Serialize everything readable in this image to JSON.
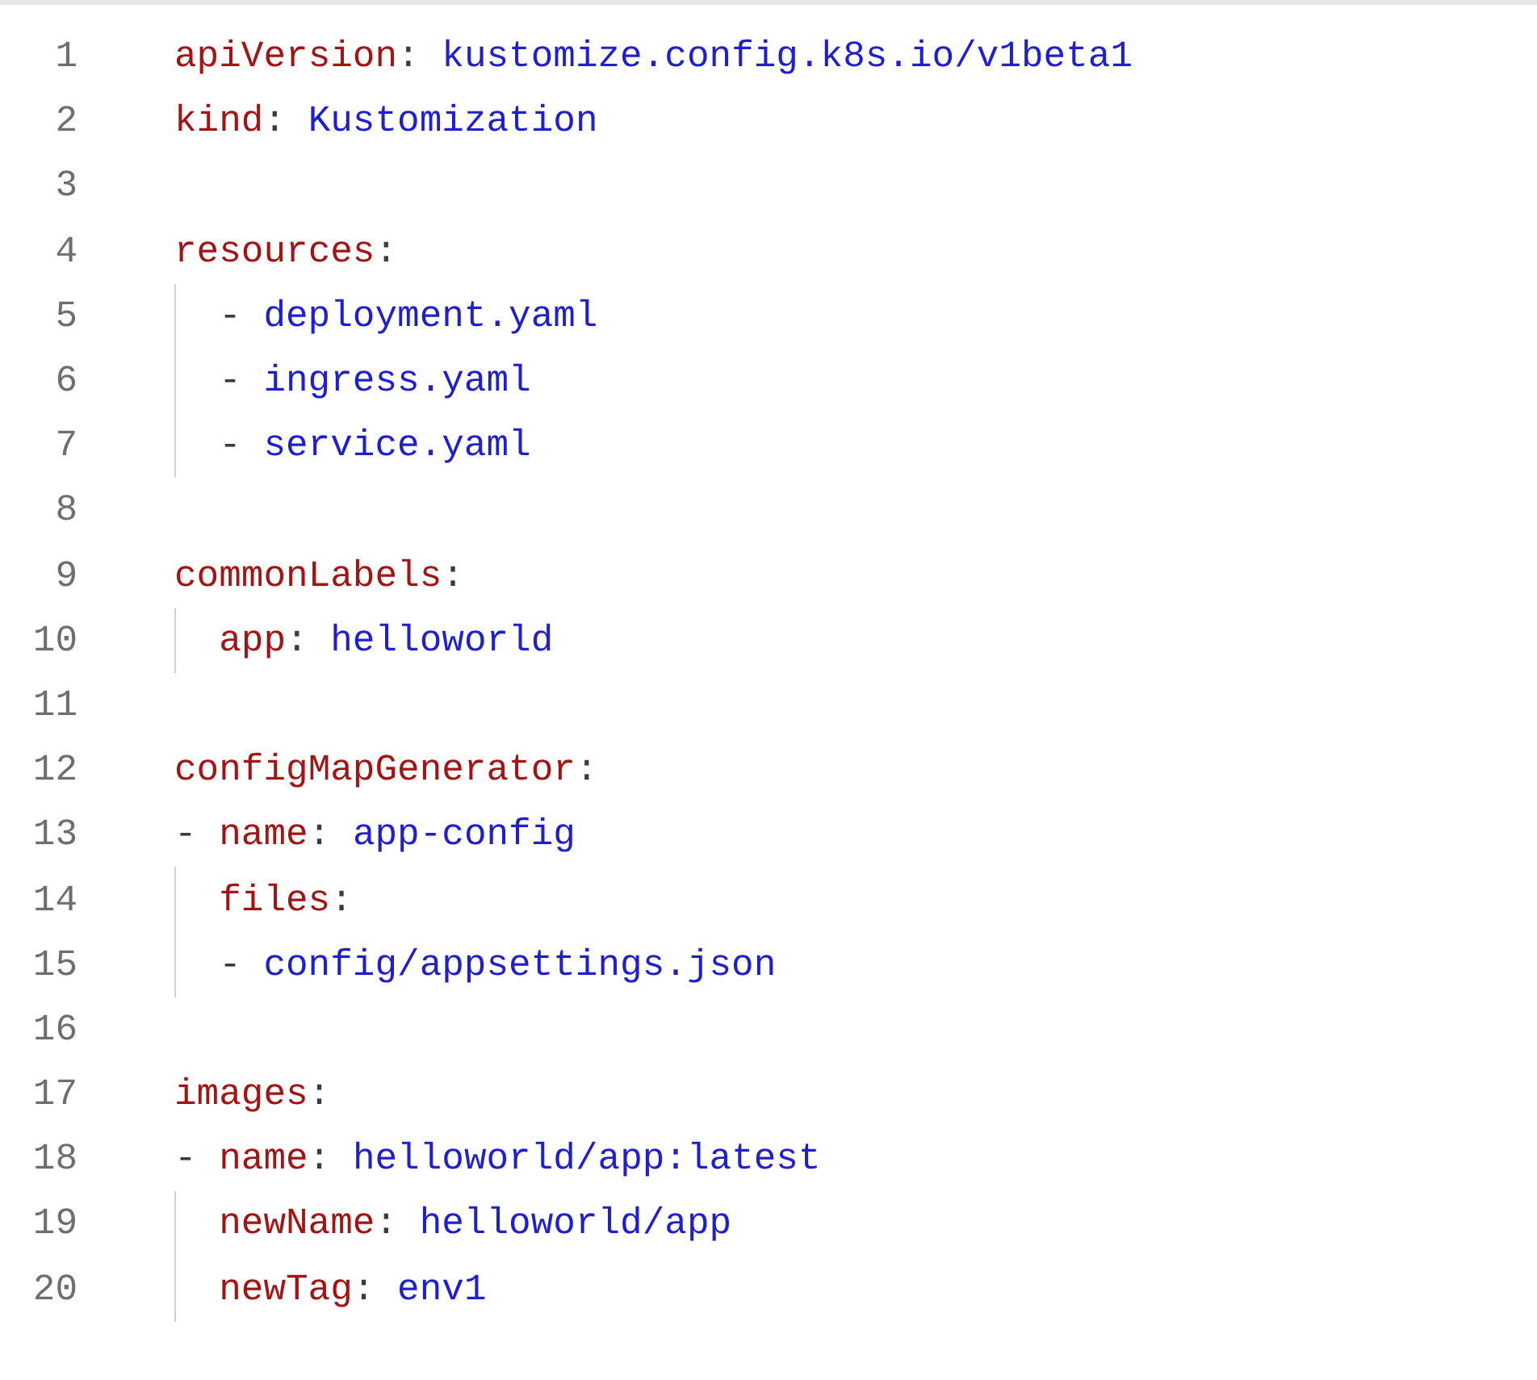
{
  "lines": [
    {
      "number": "1",
      "tokens": [
        {
          "kind": "key",
          "text": "apiVersion"
        },
        {
          "kind": "punct",
          "text": ": "
        },
        {
          "kind": "value",
          "text": "kustomize.config.k8s.io/v1beta1"
        }
      ]
    },
    {
      "number": "2",
      "tokens": [
        {
          "kind": "key",
          "text": "kind"
        },
        {
          "kind": "punct",
          "text": ": "
        },
        {
          "kind": "value",
          "text": "Kustomization"
        }
      ]
    },
    {
      "number": "3"
    },
    {
      "number": "4",
      "tokens": [
        {
          "kind": "key",
          "text": "resources"
        },
        {
          "kind": "punct",
          "text": ":"
        }
      ]
    },
    {
      "number": "5",
      "tokens": [
        {
          "kind": "guide"
        },
        {
          "kind": "punct",
          "text": "- "
        },
        {
          "kind": "value",
          "text": "deployment.yaml"
        }
      ]
    },
    {
      "number": "6",
      "tokens": [
        {
          "kind": "guide"
        },
        {
          "kind": "punct",
          "text": "- "
        },
        {
          "kind": "value",
          "text": "ingress.yaml"
        }
      ]
    },
    {
      "number": "7",
      "tokens": [
        {
          "kind": "guide"
        },
        {
          "kind": "punct",
          "text": "- "
        },
        {
          "kind": "value",
          "text": "service.yaml"
        }
      ]
    },
    {
      "number": "8"
    },
    {
      "number": "9",
      "tokens": [
        {
          "kind": "key",
          "text": "commonLabels"
        },
        {
          "kind": "punct",
          "text": ":"
        }
      ]
    },
    {
      "number": "10",
      "tokens": [
        {
          "kind": "guide"
        },
        {
          "kind": "key",
          "text": "app"
        },
        {
          "kind": "punct",
          "text": ": "
        },
        {
          "kind": "value",
          "text": "helloworld"
        }
      ]
    },
    {
      "number": "11"
    },
    {
      "number": "12",
      "tokens": [
        {
          "kind": "key",
          "text": "configMapGenerator"
        },
        {
          "kind": "punct",
          "text": ":"
        }
      ]
    },
    {
      "number": "13",
      "tokens": [
        {
          "kind": "punct",
          "text": "- "
        },
        {
          "kind": "key",
          "text": "name"
        },
        {
          "kind": "punct",
          "text": ": "
        },
        {
          "kind": "value",
          "text": "app-config"
        }
      ]
    },
    {
      "number": "14",
      "tokens": [
        {
          "kind": "guide"
        },
        {
          "kind": "key",
          "text": "files"
        },
        {
          "kind": "punct",
          "text": ":"
        }
      ]
    },
    {
      "number": "15",
      "tokens": [
        {
          "kind": "guide"
        },
        {
          "kind": "punct",
          "text": "- "
        },
        {
          "kind": "value",
          "text": "config/appsettings.json"
        }
      ]
    },
    {
      "number": "16"
    },
    {
      "number": "17",
      "tokens": [
        {
          "kind": "key",
          "text": "images"
        },
        {
          "kind": "punct",
          "text": ":"
        }
      ]
    },
    {
      "number": "18",
      "tokens": [
        {
          "kind": "punct",
          "text": "- "
        },
        {
          "kind": "key",
          "text": "name"
        },
        {
          "kind": "punct",
          "text": ": "
        },
        {
          "kind": "value",
          "text": "helloworld/app:latest"
        }
      ]
    },
    {
      "number": "19",
      "tokens": [
        {
          "kind": "guide"
        },
        {
          "kind": "key",
          "text": "newName"
        },
        {
          "kind": "punct",
          "text": ": "
        },
        {
          "kind": "value",
          "text": "helloworld/app"
        }
      ]
    },
    {
      "number": "20",
      "tokens": [
        {
          "kind": "guide"
        },
        {
          "kind": "key",
          "text": "newTag"
        },
        {
          "kind": "punct",
          "text": ": "
        },
        {
          "kind": "value",
          "text": "env1"
        }
      ]
    }
  ]
}
